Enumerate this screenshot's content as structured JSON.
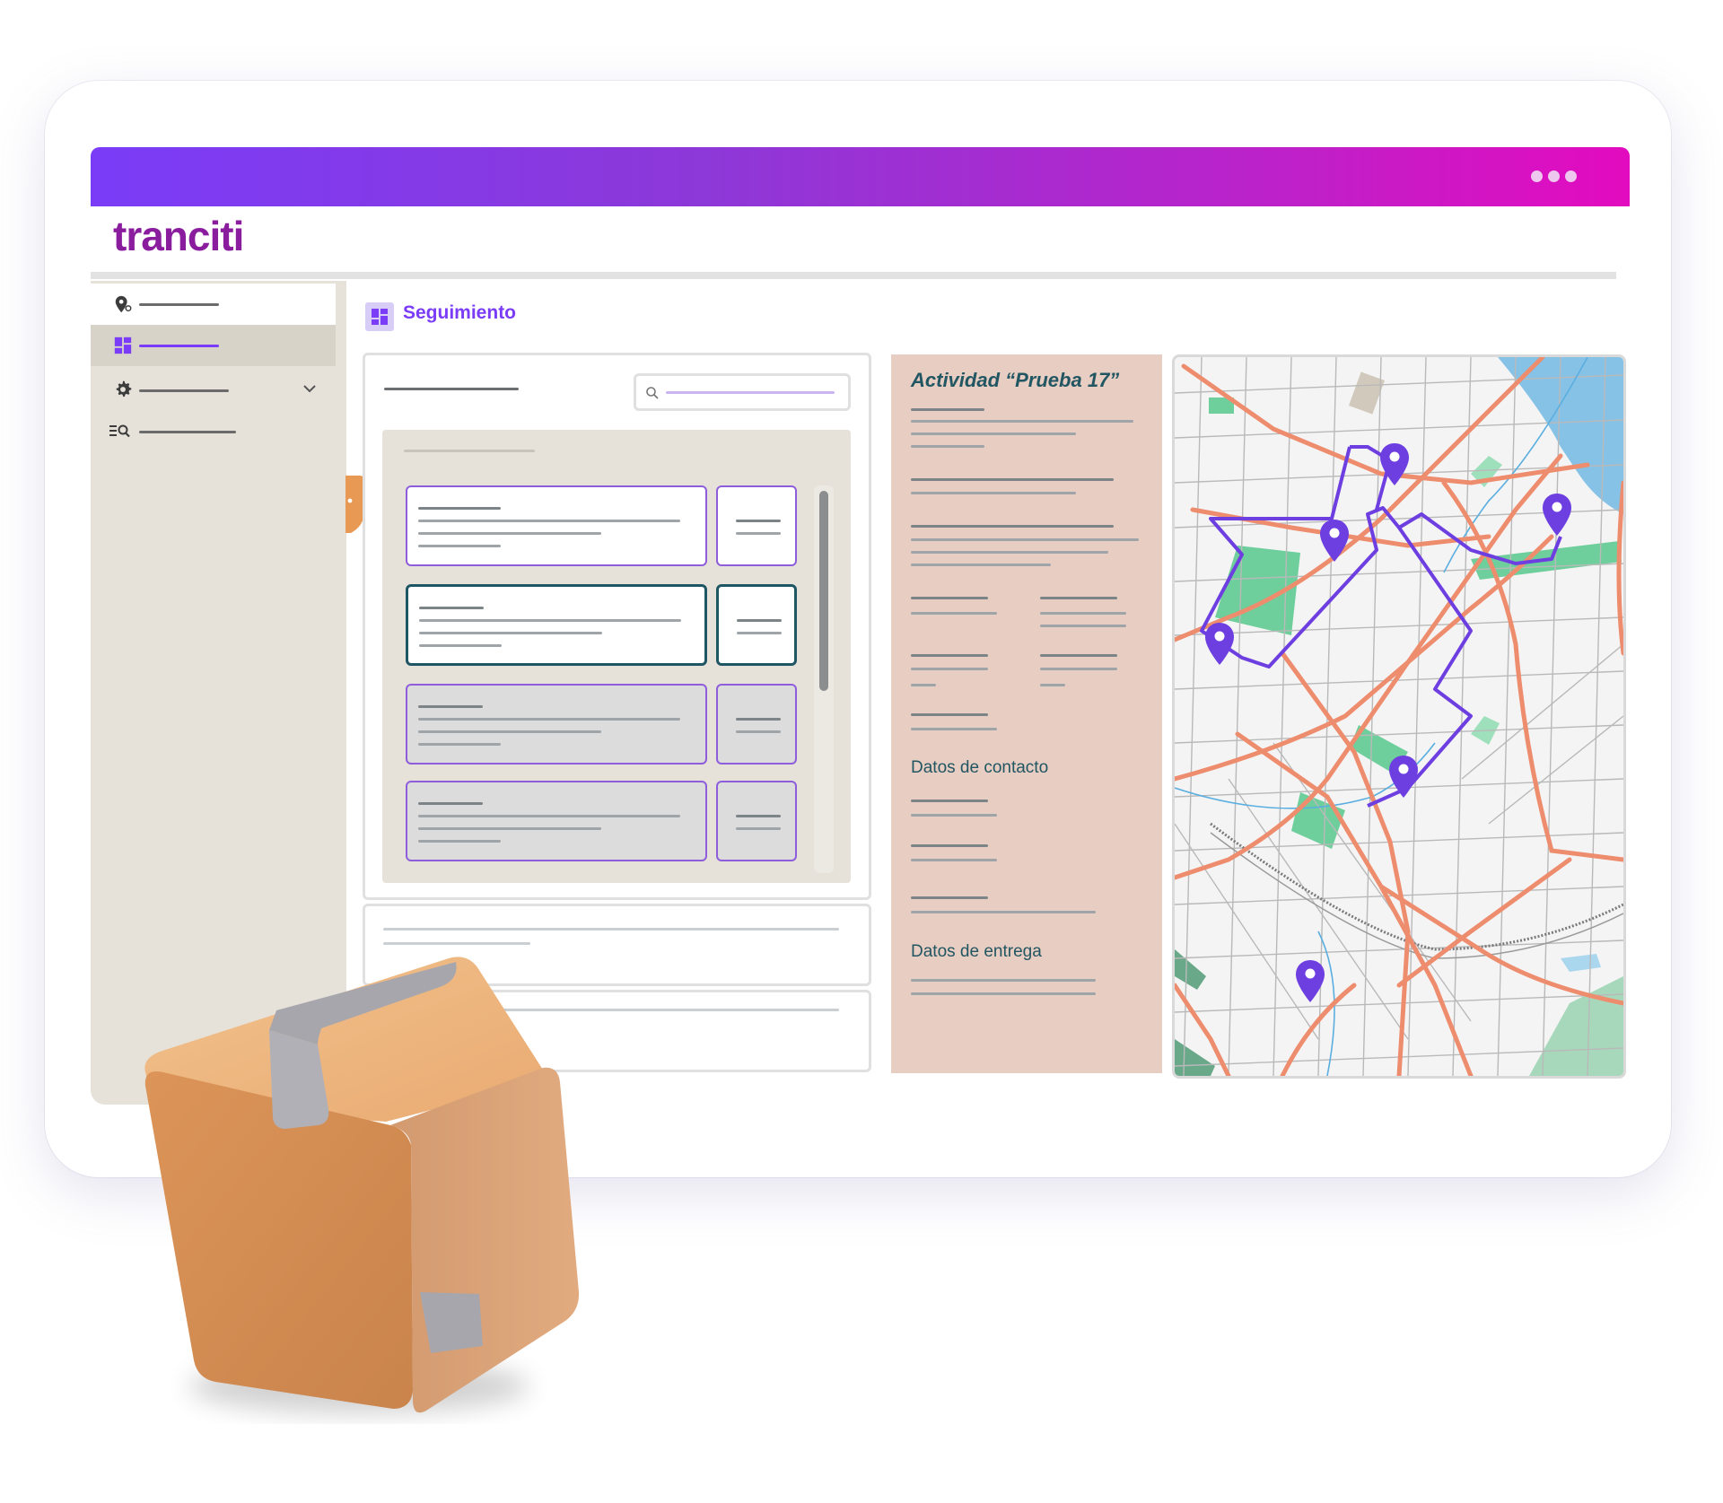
{
  "app": {
    "logo": "tranciti",
    "window_dots": [
      "dot",
      "dot",
      "dot"
    ]
  },
  "sidebar": {
    "items": [
      {
        "icon": "location-pin-icon",
        "active": false
      },
      {
        "icon": "dashboard-icon",
        "active": true
      },
      {
        "icon": "gear-icon",
        "active": false,
        "expandable": true
      },
      {
        "icon": "list-search-icon",
        "active": false
      }
    ]
  },
  "page": {
    "title": "Seguimiento",
    "title_icon": "dashboard-icon"
  },
  "list_panel": {
    "search_icon": "search-icon",
    "cards": [
      {
        "state": "normal"
      },
      {
        "state": "selected"
      },
      {
        "state": "disabled"
      },
      {
        "state": "disabled"
      }
    ]
  },
  "detail": {
    "title": "Actividad “Prueba 17”",
    "section_contact": "Datos de contacto",
    "section_delivery": "Datos de entrega"
  },
  "map": {
    "markers": 6,
    "colors": {
      "route": "#6d3ee0",
      "roads": "#ee8c6e",
      "water": "#86c2e6",
      "park": "#6fcf9c"
    }
  },
  "colors": {
    "brand": "#8a1c9e",
    "accent": "#7a3cf7",
    "selected": "#1f5663",
    "panel_bg": "#e6e2d9",
    "detail_bg": "#e8cdc2"
  },
  "decoration": {
    "box_icon": "package-box-icon"
  }
}
